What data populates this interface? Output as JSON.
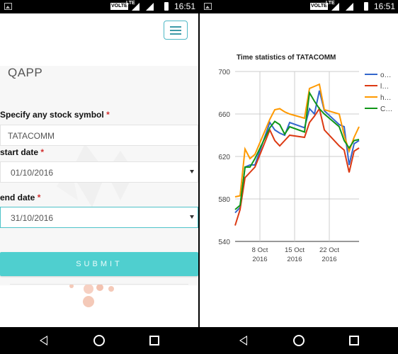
{
  "status_bar": {
    "time": "16:51",
    "network_badge": "VOLTE",
    "network_type": "LTE"
  },
  "app": {
    "title": "QAPP"
  },
  "form": {
    "symbol_label": "Specify any stock symbol",
    "symbol_value": "TATACOMM",
    "start_label": "start date",
    "start_value": "01/10/2016",
    "end_label": "end date",
    "end_value": "31/10/2016",
    "required_mark": "*",
    "submit_label": "SUBMIT"
  },
  "chart_data": {
    "type": "line",
    "title": "Time statistics of TATACOMM",
    "ylim": [
      540,
      700
    ],
    "y_ticks": [
      540,
      580,
      620,
      660,
      700
    ],
    "x_ticks": [
      {
        "label1": "8 Oct",
        "label2": "2016",
        "day": 8
      },
      {
        "label1": "15 Oct",
        "label2": "2016",
        "day": 15
      },
      {
        "label1": "22 Oct",
        "label2": "2016",
        "day": 22
      }
    ],
    "x_day_range": [
      3,
      28
    ],
    "grid": true,
    "legend_position": "right",
    "days": [
      3,
      4,
      5,
      6,
      7,
      10,
      11,
      12,
      13,
      14,
      17,
      18,
      19,
      20,
      21,
      24,
      25,
      26,
      27,
      28
    ],
    "series": [
      {
        "name": "o…",
        "color": "#3366cc",
        "values": [
          567,
          572,
          610,
          612,
          612,
          652,
          645,
          642,
          640,
          652,
          647,
          665,
          660,
          682,
          663,
          650,
          648,
          612,
          632,
          635
        ]
      },
      {
        "name": "l…",
        "color": "#dc3912",
        "values": [
          555,
          570,
          600,
          605,
          610,
          645,
          635,
          630,
          635,
          640,
          638,
          652,
          658,
          665,
          645,
          630,
          626,
          605,
          625,
          628
        ]
      },
      {
        "name": "h…",
        "color": "#ff9900",
        "values": [
          582,
          583,
          627,
          618,
          622,
          655,
          664,
          665,
          662,
          660,
          656,
          684,
          686,
          688,
          664,
          660,
          640,
          625,
          638,
          648
        ]
      },
      {
        "name": "C…",
        "color": "#109618",
        "values": [
          570,
          574,
          610,
          610,
          618,
          647,
          653,
          650,
          641,
          648,
          643,
          680,
          672,
          665,
          660,
          648,
          635,
          628,
          635,
          636
        ]
      }
    ]
  }
}
